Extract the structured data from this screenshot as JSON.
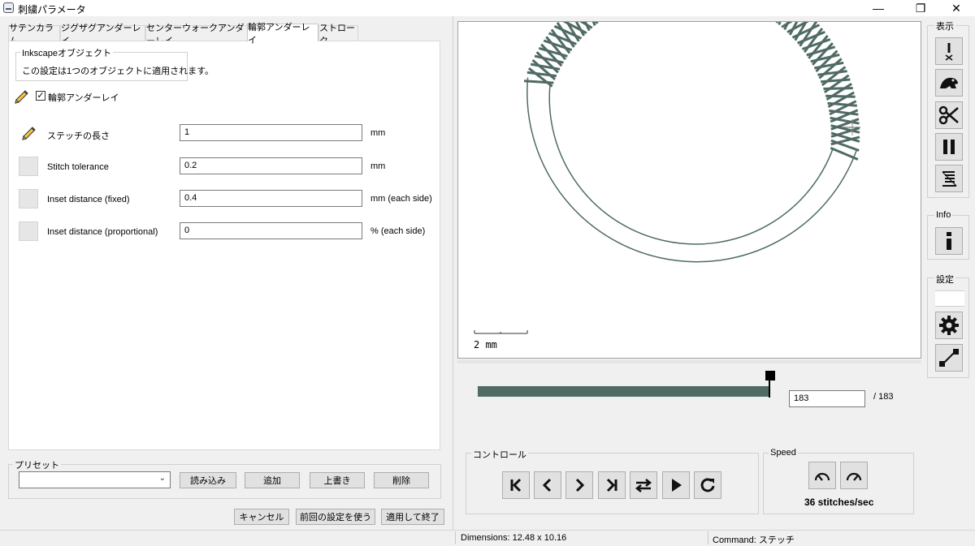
{
  "window": {
    "title": "刺繍パラメータ",
    "controls": {
      "minimize": "—",
      "restore": "❐",
      "close": "✕"
    }
  },
  "tabs": [
    {
      "label": "サテンカラム",
      "active": false
    },
    {
      "label": "ジグザグアンダーレイ",
      "active": false
    },
    {
      "label": "センターウォークアンダーレイ",
      "active": false
    },
    {
      "label": "輪郭アンダーレイ",
      "active": true
    },
    {
      "label": "ストローク",
      "active": false
    }
  ],
  "info_group": {
    "title": "Inkscapeオブジェクト",
    "text": "この設定は1つのオブジェクトに適用されます。"
  },
  "underlay_toggle": {
    "label": "輪郭アンダーレイ",
    "checked": true,
    "check_glyph": "✓"
  },
  "params": [
    {
      "label": "ステッチの長さ",
      "value": "1",
      "unit": "mm",
      "edited": true
    },
    {
      "label": "Stitch tolerance",
      "value": "0.2",
      "unit": "mm",
      "edited": false
    },
    {
      "label": "Inset distance (fixed)",
      "value": "0.4",
      "unit": "mm (each side)",
      "edited": false
    },
    {
      "label": "Inset distance (proportional)",
      "value": "0",
      "unit": "% (each side)",
      "edited": false
    }
  ],
  "preset": {
    "title": "プリセット",
    "selected": "",
    "buttons": {
      "load": "読み込み",
      "add": "追加",
      "overwrite": "上書き",
      "delete": "削除"
    }
  },
  "dialog_buttons": {
    "cancel": "キャンセル",
    "use_last": "前回の設定を使う",
    "apply_quit": "適用して終了"
  },
  "preview": {
    "scale_label": "2 mm",
    "stitch_color": "#4f6b64"
  },
  "playback": {
    "frame": "183",
    "total": "/ 183",
    "progress": 1.0,
    "controls_title": "コントロール",
    "speed_title": "Speed",
    "speed_label": "36 stitches/sec"
  },
  "toolbar": {
    "display_title": "表示",
    "info_title": "Info",
    "settings_title": "設定"
  },
  "status": {
    "dimensions": "Dimensions: 12.48 x 10.16",
    "command": "Command: ステッチ"
  },
  "colors": {
    "accent": "#4f6b64",
    "panel": "#f0f0f0",
    "button": "#e1e1e1"
  }
}
